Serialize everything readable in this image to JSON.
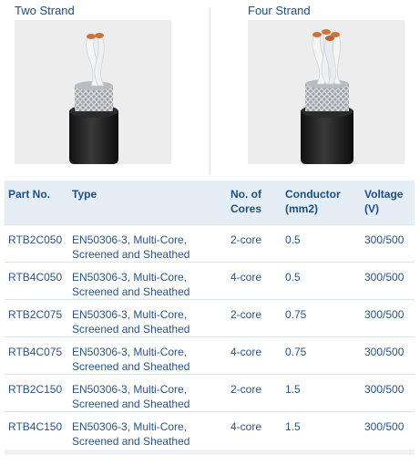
{
  "products": [
    {
      "title": "Two Strand",
      "image": "two-strand-cable"
    },
    {
      "title": "Four Strand",
      "image": "four-strand-cable"
    }
  ],
  "table": {
    "headers": [
      "Part No.",
      "Type",
      "No. of Cores",
      "Conductor (mm2)",
      "Voltage (V)"
    ],
    "rows": [
      {
        "part_no": "RTB2C050",
        "type": "EN50306-3, Multi-Core, Screened and Sheathed",
        "cores": "2-core",
        "conductor": "0.5",
        "voltage": "300/500"
      },
      {
        "part_no": "RTB4C050",
        "type": "EN50306-3, Multi-Core, Screened and Sheathed",
        "cores": "4-core",
        "conductor": "0.5",
        "voltage": "300/500"
      },
      {
        "part_no": "RTB2C075",
        "type": "EN50306-3, Multi-Core, Screened and Sheathed",
        "cores": "2-core",
        "conductor": "0.75",
        "voltage": "300/500"
      },
      {
        "part_no": "RTB4C075",
        "type": "EN50306-3, Multi-Core, Screened and Sheathed",
        "cores": "4-core",
        "conductor": "0.75",
        "voltage": "300/500"
      },
      {
        "part_no": "RTB2C150",
        "type": "EN50306-3, Multi-Core, Screened and Sheathed",
        "cores": "2-core",
        "conductor": "1.5",
        "voltage": "300/500"
      },
      {
        "part_no": "RTB4C150",
        "type": "EN50306-3, Multi-Core, Screened and Sheathed",
        "cores": "4-core",
        "conductor": "1.5",
        "voltage": "300/500"
      }
    ]
  },
  "colors": {
    "text": "#1f4f82",
    "header_bg": "#e5eef6",
    "image_bg": "#ededed",
    "sheath": "#1c1c1c",
    "insulation": "#f4f6f8",
    "copper": "#c8743a"
  }
}
